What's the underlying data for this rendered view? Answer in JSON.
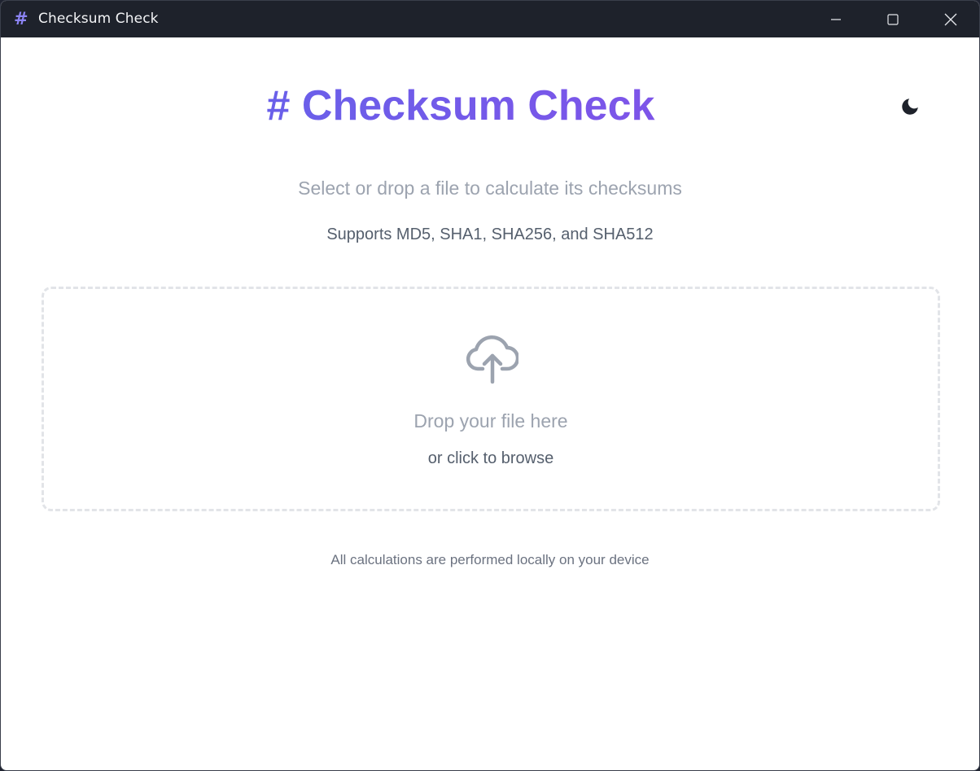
{
  "window": {
    "icon_glyph": "#",
    "title": "Checksum Check",
    "controls": [
      "minimize-icon",
      "maximize-icon",
      "close-icon"
    ]
  },
  "header": {
    "title": "# Checksum Check",
    "gradient": [
      "#5b67ea",
      "#8b4de8"
    ],
    "theme_toggle_icon": "moon-icon"
  },
  "intro": {
    "subtitle": "Select or drop a file to calculate its checksums",
    "supports": "Supports MD5, SHA1, SHA256, and SHA512"
  },
  "dropzone": {
    "icon": "cloud-upload-icon",
    "primary": "Drop your file here",
    "secondary": "or click to browse"
  },
  "footer": {
    "note": "All calculations are performed locally on your device"
  },
  "colors": {
    "titlebar_bg": "#1e222b",
    "accent_start": "#5b67ea",
    "accent_end": "#8b4de8",
    "muted_text": "#9ca3af",
    "secondary_text": "#555f6d"
  }
}
